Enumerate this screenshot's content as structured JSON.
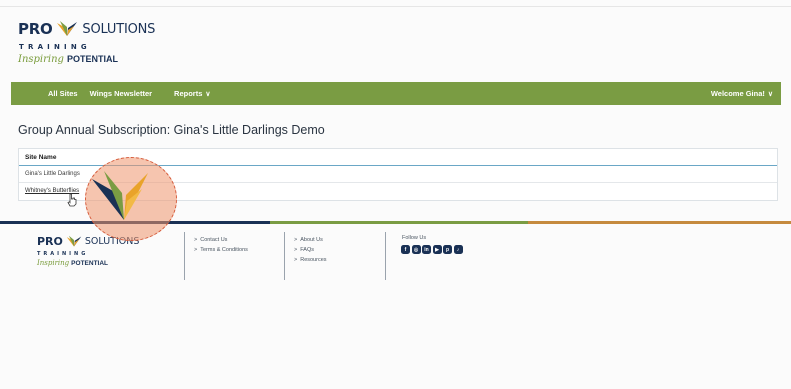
{
  "brand": {
    "pro": "PRO",
    "solutions": "SOLUTIONS",
    "training": "TRAINING",
    "tagline_script": "Inspiring",
    "tagline_rest": "POTENTIAL",
    "colors": {
      "navy": "#1a3155",
      "green": "#7a9c43",
      "orange": "#c58a3e"
    }
  },
  "nav": {
    "items": [
      "All Sites",
      "Wings Newsletter",
      "Reports"
    ],
    "reports_chevron": "∨",
    "welcome": "Welcome Gina!",
    "welcome_chevron": "∨"
  },
  "page": {
    "title": "Group Annual Subscription: Gina's Little Darlings Demo"
  },
  "table": {
    "header": "Site Name",
    "rows": [
      "Gina's Little Darlings",
      "Whitney's Butterflies"
    ]
  },
  "footer": {
    "links_col1": [
      "Contact Us",
      "Terms & Conditions"
    ],
    "links_col2": [
      "About Us",
      "FAQs",
      "Resources"
    ],
    "follow_label": "Follow Us",
    "socials": [
      "facebook-icon",
      "instagram-icon",
      "linkedin-icon",
      "youtube-icon",
      "pinterest-icon",
      "tiktok-icon"
    ]
  }
}
